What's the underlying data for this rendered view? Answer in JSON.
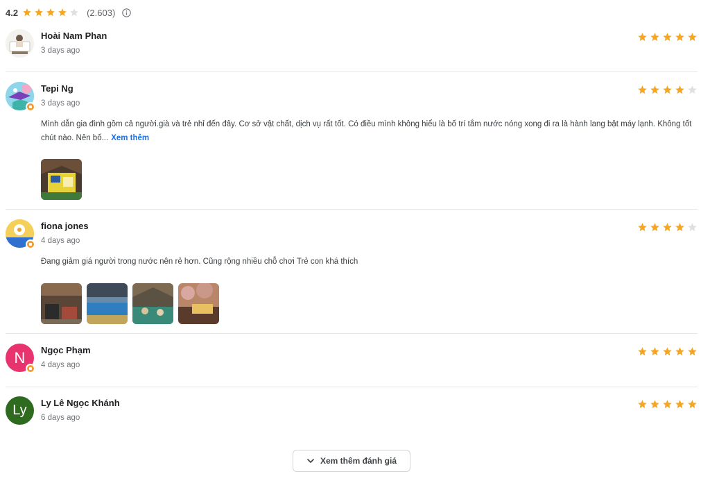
{
  "summary": {
    "rating": "4.2",
    "rating_value": 4.2,
    "count": "(2.603)",
    "star_fill": [
      1,
      1,
      1,
      1,
      0
    ],
    "icon": "info-icon"
  },
  "colors": {
    "star_filled": "#f5a623",
    "star_empty": "#e0e0e0",
    "link": "#1a73e8",
    "badge": "#f39c34"
  },
  "reviews": [
    {
      "name": "Hoài Nam Phan",
      "date": "3 days ago",
      "rating": 5,
      "avatar": "photo-avatar",
      "text": "",
      "more": "",
      "photos": 0
    },
    {
      "name": "Tepi Ng",
      "date": "3 days ago",
      "rating": 4,
      "avatar": "photo-avatar",
      "text": "Mình dẫn gia đình gồm cả người.già và trẻ nhỉ đến đây. Cơ sở vật chất, dịch vụ rất tốt. Có điều mình không hiểu là bố trí tắm nước nóng xong đi ra là hành lang bật máy lạnh. Không tốt chút nào. Nên bố...",
      "more": "Xem thêm",
      "photos": 1
    },
    {
      "name": "fiona jones",
      "date": "4 days ago",
      "rating": 4,
      "avatar": "photo-avatar",
      "text": "Đang giảm giá người trong nước nên rẻ hơn. Cũng rộng nhiều chỗ chơi Trẻ con khá thích",
      "more": "",
      "photos": 4
    },
    {
      "name": "Ngọc Phạm",
      "date": "4 days ago",
      "rating": 5,
      "avatar": "letter-avatar",
      "avatar_letter": "N",
      "avatar_color": "#e8336f",
      "text": "",
      "more": "",
      "photos": 0
    },
    {
      "name": "Ly Lê Ngọc Khánh",
      "date": "6 days ago",
      "rating": 5,
      "avatar": "letter-avatar",
      "avatar_letter": "Ly",
      "avatar_color": "#2e6b1f",
      "text": "",
      "more": "",
      "photos": 0
    }
  ],
  "load_more": {
    "label": "Xem thêm đánh giá",
    "icon": "chevron-down-icon"
  }
}
